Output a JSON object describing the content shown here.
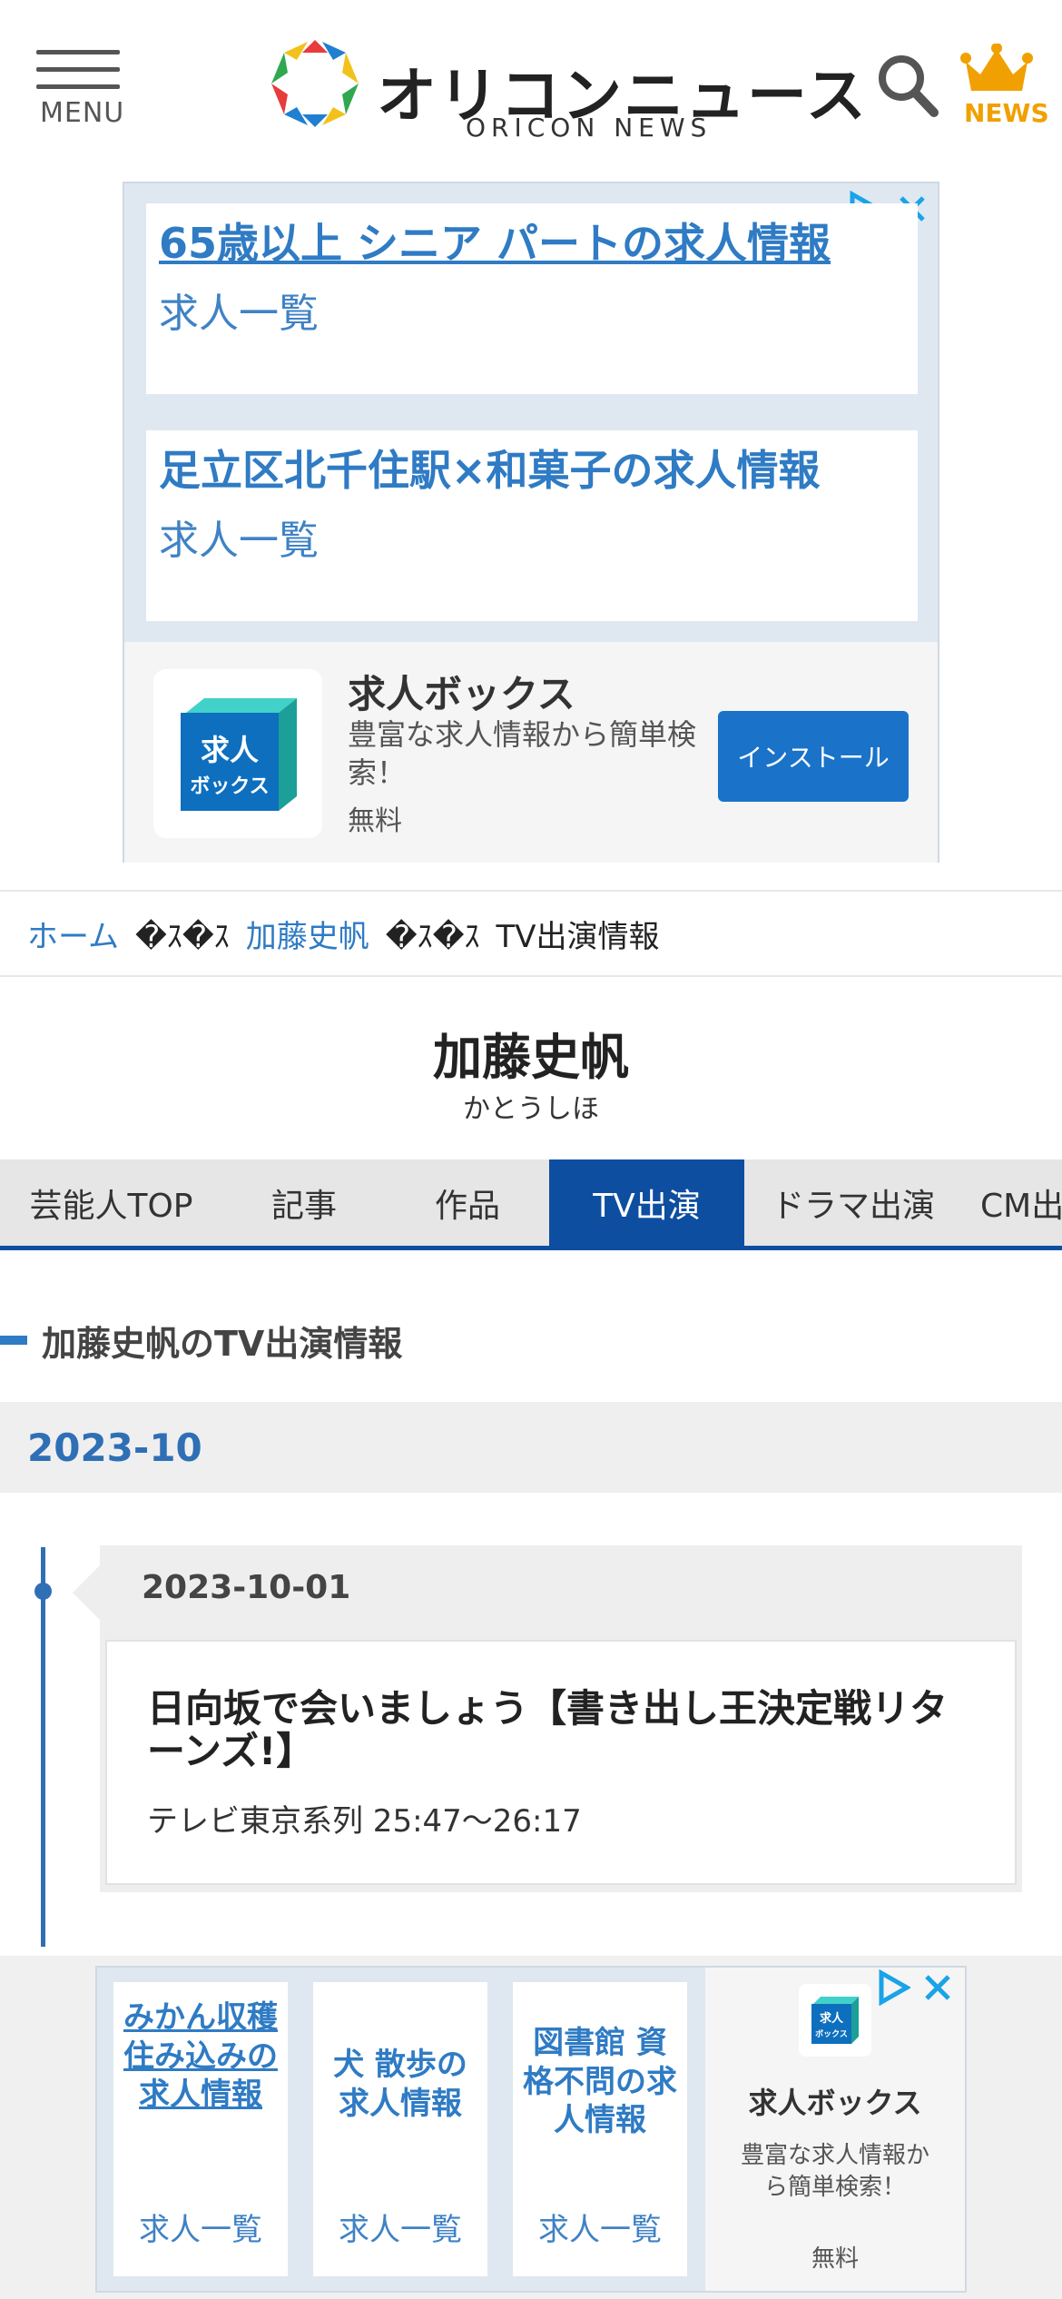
{
  "header": {
    "menu_label": "MENU",
    "logo_jp": "オリコンニュース",
    "logo_en": "ORICON NEWS",
    "news_label": "NEWS"
  },
  "ad_top": {
    "cards": [
      {
        "title": "65歳以上 シニア パートの求人情報",
        "sub": "求人一覧"
      },
      {
        "title": "足立区北千住駅×和菓子の求人情報",
        "sub": "求人一覧"
      }
    ],
    "app": {
      "icon_text_1": "求人",
      "icon_text_2": "ボックス",
      "name": "求人ボックス",
      "desc": "豊富な求人情報から簡単検索！",
      "price": "無料",
      "install": "インストール"
    }
  },
  "breadcrumb": {
    "home": "ホーム",
    "sep": "�ｽ�ｽ",
    "person": "加藤史帆",
    "current": "TV出演情報"
  },
  "person": {
    "name": "加藤史帆",
    "kana": "かとうしほ"
  },
  "tabs": [
    {
      "label": "芸能人TOP"
    },
    {
      "label": "記事"
    },
    {
      "label": "作品"
    },
    {
      "label": "TV出演"
    },
    {
      "label": "ドラマ出演"
    },
    {
      "label": "CM出"
    }
  ],
  "section_title": "加藤史帆のTV出演情報",
  "month": "2023-10",
  "entries": [
    {
      "date": "2023-10-01",
      "title": "日向坂で会いましょう【書き出し王決定戦リターンズ!】",
      "channel": "テレビ東京系列 25:47〜26:17"
    }
  ],
  "ad_bottom": {
    "cards": [
      {
        "title": "みかん収穫 住み込みの求人情報",
        "sub": "求人一覧"
      },
      {
        "title": "犬 散歩の求人情報",
        "sub": "求人一覧"
      },
      {
        "title": "図書館 資格不問の求人情報",
        "sub": "求人一覧"
      }
    ],
    "app": {
      "name": "求人ボックス",
      "desc": "豊富な求人情報から簡単検索！",
      "price": "無料"
    }
  },
  "colors": {
    "accent_blue": "#0e4ea0",
    "link_blue": "#2f7bc4",
    "news_gold": "#f0a000"
  }
}
